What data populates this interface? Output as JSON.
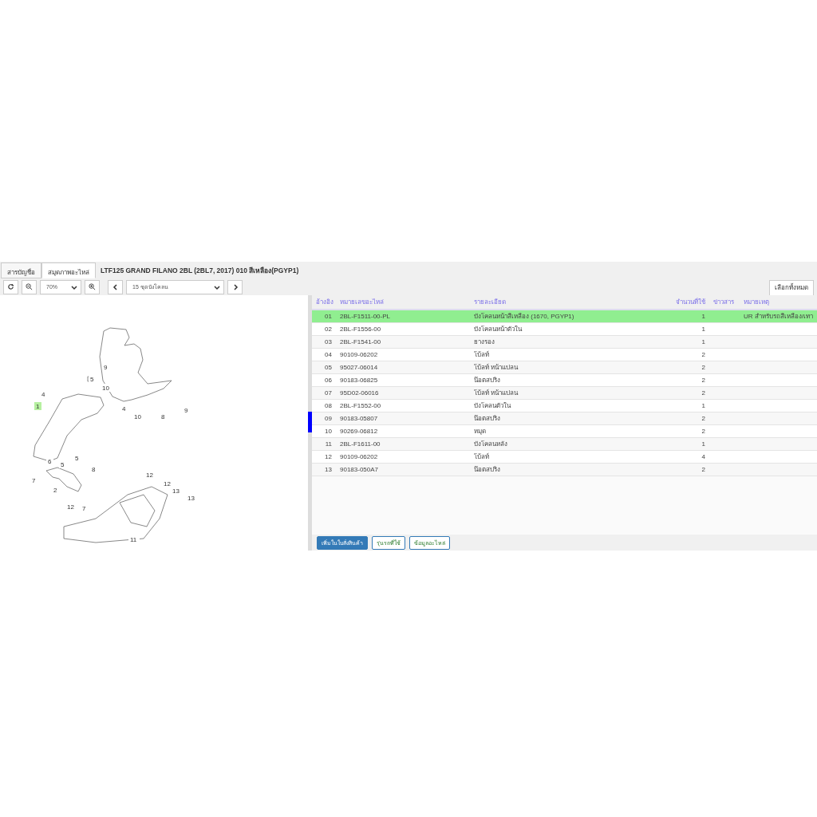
{
  "tabs": [
    {
      "label": "สารบัญชื่อ",
      "selected": false
    },
    {
      "label": "สมุดภาพอะไหล่",
      "selected": true
    }
  ],
  "title": "LTF125 GRAND FILANO 2BL (2BL7, 2017) 010 สีเหลือง(PGYP1)",
  "toolbar": {
    "zoom": "70%",
    "page": "15 ชุดบังโคลน",
    "select_all": "เลือกทั้งหมด"
  },
  "diagram": {
    "callouts": [
      {
        "label": "9",
        "selected": false
      },
      {
        "label": "5",
        "selected": false
      },
      {
        "label": "4",
        "selected": false
      },
      {
        "label": "1",
        "selected": true
      },
      {
        "label": "10",
        "selected": false
      },
      {
        "label": "10",
        "selected": false
      },
      {
        "label": "8",
        "selected": false
      },
      {
        "label": "9",
        "selected": false
      },
      {
        "label": "4",
        "selected": false
      },
      {
        "label": "6",
        "selected": false
      },
      {
        "label": "5",
        "selected": false
      },
      {
        "label": "5",
        "selected": false
      },
      {
        "label": "8",
        "selected": false
      },
      {
        "label": "7",
        "selected": false
      },
      {
        "label": "2",
        "selected": false
      },
      {
        "label": "7",
        "selected": false
      },
      {
        "label": "12",
        "selected": false
      },
      {
        "label": "12",
        "selected": false
      },
      {
        "label": "12",
        "selected": false
      },
      {
        "label": "13",
        "selected": false
      },
      {
        "label": "13",
        "selected": false
      },
      {
        "label": "11",
        "selected": false
      }
    ]
  },
  "table": {
    "columns": [
      "อ้างอิง",
      "หมายเลขอะไหล่",
      "รายละเอียด",
      "จำนวนที่ใช้",
      "ข่าวสาร",
      "หมายเหตุ"
    ],
    "rows": [
      {
        "ref": "01",
        "part": "2BL-F1511-00-PL",
        "desc": "บังโคลนหน้าสีเหลือง (1670, PGYP1)",
        "qty": "1",
        "note": "UR สำหรับรถสีเหลือง/เทา",
        "selected": true
      },
      {
        "ref": "02",
        "part": "2BL-F1556-00",
        "desc": "บังโคลนหน้าตัวใน",
        "qty": "1",
        "selected": false
      },
      {
        "ref": "03",
        "part": "2BL-F1541-00",
        "desc": "ยางรอง",
        "qty": "1",
        "selected": false
      },
      {
        "ref": "04",
        "part": "90109-06202",
        "desc": "โบ้ลท์",
        "qty": "2",
        "selected": false
      },
      {
        "ref": "05",
        "part": "95027-06014",
        "desc": "โบ้ลท์ หน้าแปลน",
        "qty": "2",
        "selected": false
      },
      {
        "ref": "06",
        "part": "90183-06825",
        "desc": "น๊อตสปริง",
        "qty": "2",
        "selected": false
      },
      {
        "ref": "07",
        "part": "95D02-06016",
        "desc": "โบ้ลท์ หน้าแปลน",
        "qty": "2",
        "selected": false
      },
      {
        "ref": "08",
        "part": "2BL-F1552-00",
        "desc": "บังโคลนตัวใน",
        "qty": "1",
        "selected": false
      },
      {
        "ref": "09",
        "part": "90183-05807",
        "desc": "น๊อตสปริง",
        "qty": "2",
        "selected": false
      },
      {
        "ref": "10",
        "part": "90269-06812",
        "desc": "หมุด",
        "qty": "2",
        "selected": false
      },
      {
        "ref": "11",
        "part": "2BL-F1611-00",
        "desc": "บังโคลนหลัง",
        "qty": "1",
        "selected": false
      },
      {
        "ref": "12",
        "part": "90109-06202",
        "desc": "โบ้ลท์",
        "qty": "4",
        "selected": false
      },
      {
        "ref": "13",
        "part": "90183-050A7",
        "desc": "น๊อตสปริง",
        "qty": "2",
        "selected": false
      }
    ]
  },
  "buttons": [
    {
      "label": "เพิ่มในใบสั่งสินค้า",
      "kind": "primary"
    },
    {
      "label": "รุ่นรถที่ใช้",
      "kind": "outline"
    },
    {
      "label": "ข้อมูลอะไหล่",
      "kind": "outline"
    }
  ]
}
